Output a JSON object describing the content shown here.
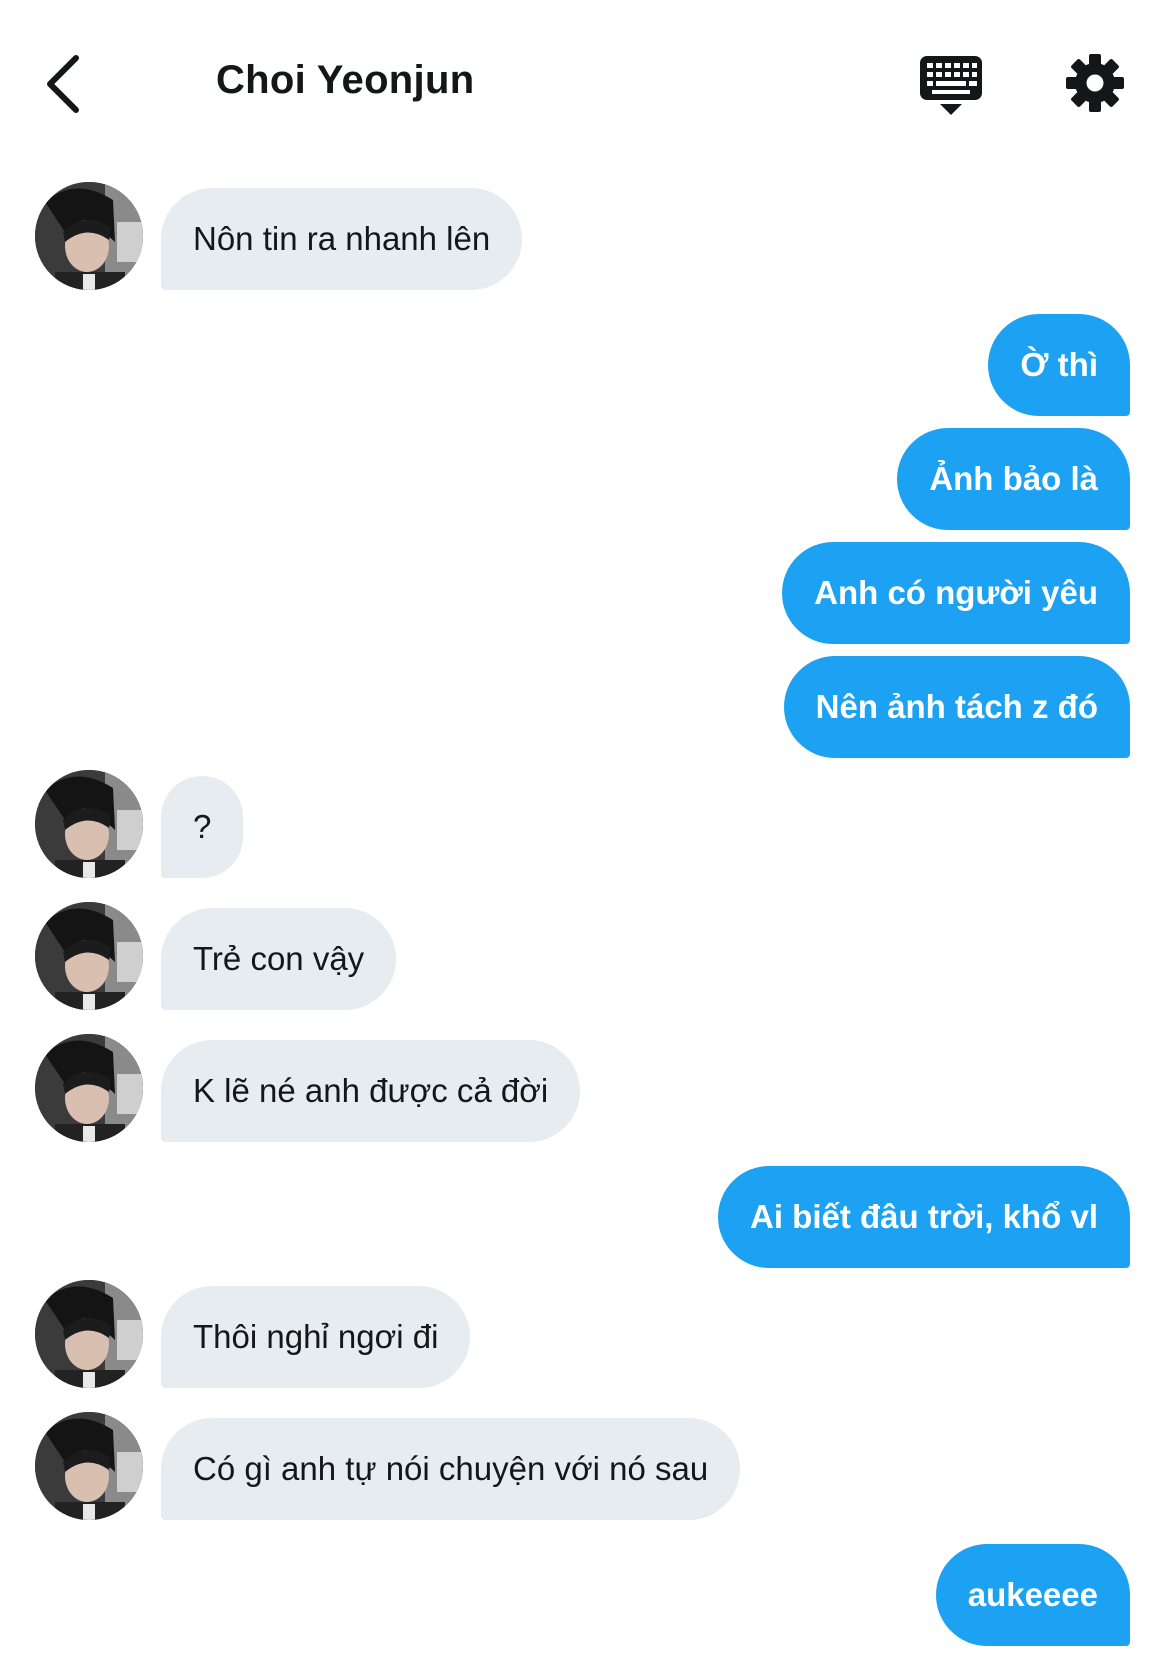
{
  "header": {
    "title": "Choi Yeonjun"
  },
  "messages": [
    {
      "side": "in",
      "text": "Nôn tin ra nhanh lên"
    },
    {
      "side": "out",
      "text": "Ờ thì"
    },
    {
      "side": "out",
      "text": "Ảnh bảo là"
    },
    {
      "side": "out",
      "text": "Anh có người yêu"
    },
    {
      "side": "out",
      "text": "Nên ảnh tách z đó"
    },
    {
      "side": "in",
      "text": "?"
    },
    {
      "side": "in",
      "text": "Trẻ con vậy"
    },
    {
      "side": "in",
      "text": "K lẽ né anh được cả đời"
    },
    {
      "side": "out",
      "text": "Ai biết đâu trời, khổ vl"
    },
    {
      "side": "in",
      "text": "Thôi nghỉ ngơi đi"
    },
    {
      "side": "in",
      "text": "Có gì anh tự nói chuyện với nó sau"
    },
    {
      "side": "out",
      "text": "aukeeee"
    }
  ],
  "colors": {
    "incoming_bubble": "#e6ecf0",
    "outgoing_bubble": "#1da1f2",
    "text_dark": "#14171a"
  },
  "icons": {
    "back": "chevron-left-icon",
    "keyboard": "keyboard-icon",
    "settings": "gear-icon"
  }
}
